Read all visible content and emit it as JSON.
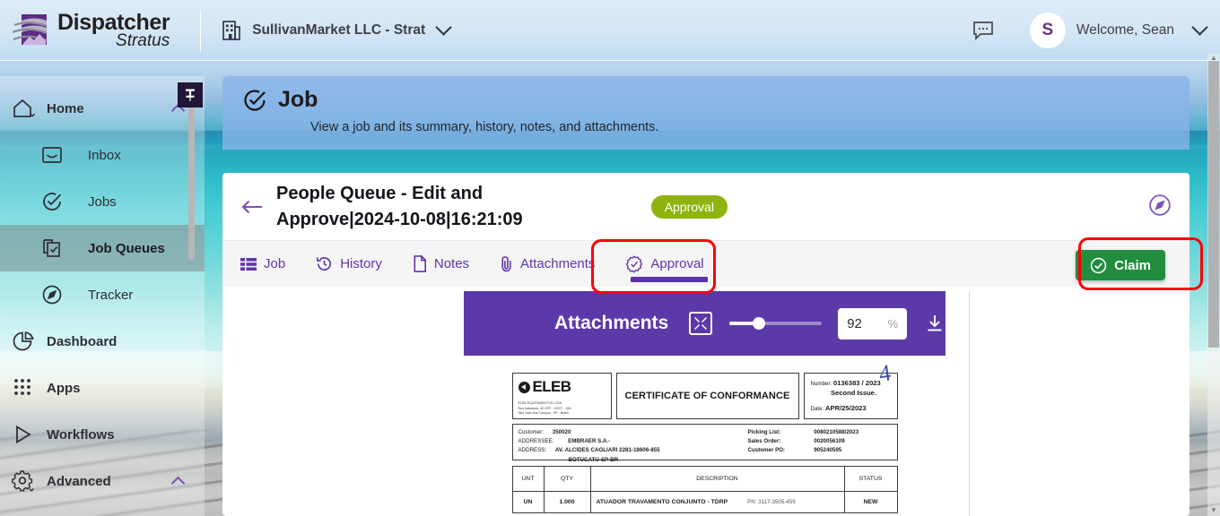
{
  "topbar": {
    "logo_line1": "Dispatcher",
    "logo_line2": "Stratus",
    "org_name": "SullivanMarket LLC - Strat",
    "org_icon": "building-icon",
    "chat_icon": "chat-bubble-icon",
    "avatar_initial": "S",
    "welcome_label": "Welcome, Sean",
    "user_chevron_icon": "chevron-down-icon"
  },
  "sidebar": {
    "pin_icon": "pin-icon",
    "items": [
      {
        "label": "Home",
        "icon": "home-icon",
        "type": "group",
        "expanded": true
      },
      {
        "label": "Inbox",
        "icon": "inbox-icon",
        "type": "sub",
        "active": false
      },
      {
        "label": "Jobs",
        "icon": "check-circle-icon",
        "type": "sub",
        "active": false
      },
      {
        "label": "Job Queues",
        "icon": "documents-check-icon",
        "type": "sub",
        "active": true
      },
      {
        "label": "Tracker",
        "icon": "compass-icon",
        "type": "sub",
        "active": false
      },
      {
        "label": "Dashboard",
        "icon": "pie-chart-icon",
        "type": "group",
        "expanded": false
      },
      {
        "label": "Apps",
        "icon": "grid-dots-icon",
        "type": "group",
        "expanded": false
      },
      {
        "label": "Workflows",
        "icon": "play-triangle-icon",
        "type": "group",
        "expanded": false
      },
      {
        "label": "Advanced",
        "icon": "gear-icon",
        "type": "group",
        "expanded": true
      }
    ]
  },
  "banner": {
    "icon": "check-circle-icon",
    "title": "Job",
    "subtitle": "View a job and its summary, history, notes, and attachments."
  },
  "job": {
    "back_icon": "arrow-left-icon",
    "title_line1": "People Queue - Edit and",
    "title_line2": "Approve|2024-10-08|16:21:09",
    "status_badge": "Approval",
    "status_badge_color": "#8fb40f",
    "compass_icon": "compass-icon"
  },
  "tabs": [
    {
      "label": "Job",
      "icon": "list-icon",
      "active": false
    },
    {
      "label": "History",
      "icon": "clock-back-icon",
      "active": false
    },
    {
      "label": "Notes",
      "icon": "page-icon",
      "active": false
    },
    {
      "label": "Attachments",
      "icon": "paperclip-icon",
      "active": false
    },
    {
      "label": "Approval",
      "icon": "seal-check-icon",
      "active": true
    }
  ],
  "claim_button": {
    "label": "Claim",
    "icon": "check-circle-icon",
    "color": "#228c3f"
  },
  "highlights": [
    {
      "name": "approval-tab-highlight",
      "color": "#ff0000"
    },
    {
      "name": "claim-button-highlight",
      "color": "#ff0000"
    }
  ],
  "viewer": {
    "title": "Attachments",
    "fit_icon": "fit-to-screen-icon",
    "zoom_value": "92",
    "zoom_unit": "%",
    "download_icon": "download-icon",
    "header_color": "#5b39a8"
  },
  "document": {
    "annotation": "4",
    "company": {
      "name": "ELEB",
      "legal_name": "ELEB EQUIPAMENTOS LTDA",
      "address_line1": "Rua Itabaiana, 40    CEP - 12227 - 540",
      "address_line2": "São José dos Campos - SP - Brasil"
    },
    "cert_title": "CERTIFICATE OF CONFORMANCE",
    "number_label": "Number:",
    "number_value": "0136383 / 2023",
    "issue_note": "Second Issue.",
    "date_label": "Date:",
    "date_value": "APR/25/2023",
    "customer": {
      "customer_label": "Customer:",
      "customer_value": "350020",
      "addressee_label": "ADDRESSEE:",
      "addressee_value": "EMBRAER S.A.-",
      "address_label": "ADDRESS:",
      "address_value": "AV. ALCIDES CAGLIARI 2281-18606-855",
      "address_value2": "BOTUCATU-SP-BR"
    },
    "order": {
      "picking_list_label": "Picking List:",
      "picking_list_value": "0080210588/2023",
      "sales_order_label": "Sales Order:",
      "sales_order_value": "0020056109",
      "customer_po_label": "Customer PO:",
      "customer_po_value": "905240595"
    },
    "table": {
      "headers": [
        "UNT",
        "QTY",
        "DESCRIPTION",
        "STATUS"
      ],
      "rows": [
        {
          "unt": "UN",
          "qty": "1.000",
          "description": "ATUADOR TRAVAMENTO CONJUNTO - TDRP",
          "part_number": "PN: 3117-3505-459",
          "status": "NEW"
        }
      ]
    }
  }
}
